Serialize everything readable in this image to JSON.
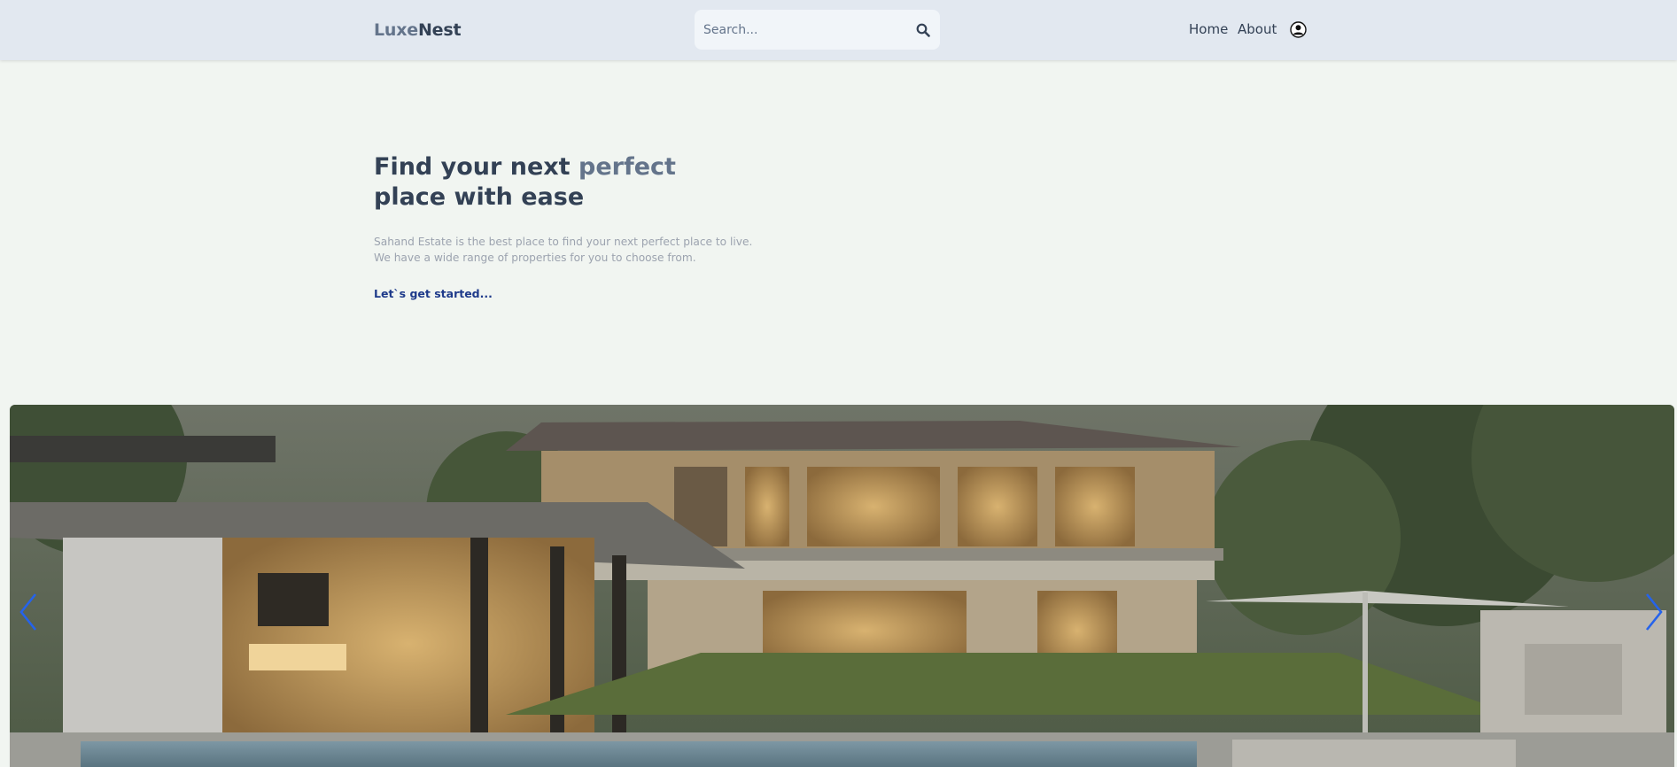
{
  "header": {
    "logo_part1": "Luxe",
    "logo_part2": "Nest",
    "search_placeholder": "Search...",
    "nav": {
      "home": "Home",
      "about": "About"
    }
  },
  "hero": {
    "title_line1_start": "Find your next ",
    "title_line1_highlight": "perfect",
    "title_line2": "place with ease",
    "description_line1": "Sahand Estate is the best place to find your next perfect place to live.",
    "description_line2": "We have a wide range of properties for you to choose from.",
    "cta_label": "Let`s get started..."
  },
  "icons": {
    "search": "search-icon",
    "profile": "user-circle-icon",
    "prev": "chevron-left-icon",
    "next": "chevron-right-icon"
  },
  "colors": {
    "header_bg": "#e2e8f0",
    "page_bg": "#f1f5f1",
    "text_dark": "#334155",
    "text_muted": "#64748b",
    "cta": "#1e3a8a",
    "carousel_arrow": "#2563eb"
  }
}
